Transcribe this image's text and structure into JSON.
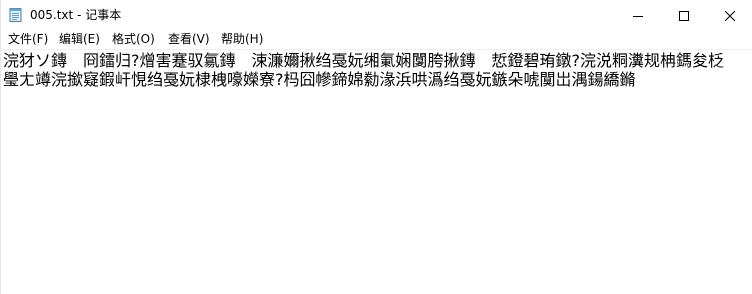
{
  "window": {
    "title": "005.txt - 记事本",
    "icons": {
      "app": "notepad-icon",
      "minimize": "minimize-icon",
      "maximize": "maximize-icon",
      "close": "close-icon"
    }
  },
  "menu": {
    "items": [
      {
        "label": "文件(F)"
      },
      {
        "label": "编辑(E)"
      },
      {
        "label": "格式(O)"
      },
      {
        "label": "查看(V)"
      },
      {
        "label": "帮助(H)"
      }
    ]
  },
  "document": {
    "content": "浣犲ソ鏄　冏鐳归?熷害蹇驭氱鏄　涑濂嬭揪绉戞妧缃氭娴闅胯揪鏄　悊鐙碧珛鐓?浣涚粡瀵规柟鎷夋柉璺ㄤ竴浣撳寲鍜屽悓绉戞妧棣栧嚎嬫寮?杩囧幓鍗婂勬湪浜哄潙绉戞妧鏃朵唬闃岀湡鍚繑鏅"
  }
}
